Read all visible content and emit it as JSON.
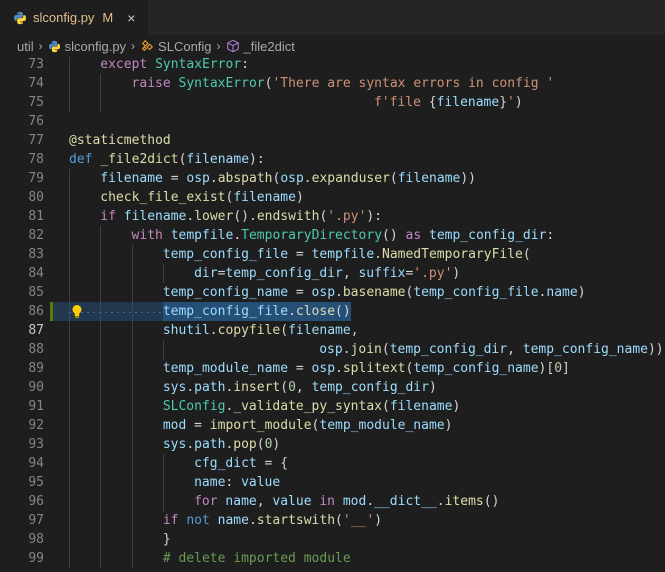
{
  "tab": {
    "filename": "slconfig.py",
    "status": "M",
    "close": "×"
  },
  "breadcrumb": {
    "items": [
      "util",
      "slconfig.py",
      "SLConfig",
      "_file2dict"
    ],
    "sep": "›"
  },
  "lines": [
    {
      "n": "73",
      "tokens": [
        [
          "kw",
          "except"
        ],
        [
          "op",
          " "
        ],
        [
          "cls",
          "SyntaxError"
        ],
        [
          "op",
          ":"
        ]
      ]
    },
    {
      "n": "74",
      "tokens": [
        [
          "kw",
          "raise"
        ],
        [
          "op",
          " "
        ],
        [
          "cls",
          "SyntaxError"
        ],
        [
          "op",
          "("
        ],
        [
          "str",
          "'There are syntax errors in config '"
        ]
      ]
    },
    {
      "n": "75",
      "tokens": [
        [
          "str",
          "f'file "
        ],
        [
          "op",
          "{"
        ],
        [
          "var",
          "filename"
        ],
        [
          "op",
          "}"
        ],
        [
          "str",
          "'"
        ],
        [
          "op",
          ")"
        ]
      ]
    },
    {
      "n": "76",
      "tokens": []
    },
    {
      "n": "77",
      "tokens": [
        [
          "dec",
          "@staticmethod"
        ]
      ]
    },
    {
      "n": "78",
      "tokens": [
        [
          "kw2",
          "def"
        ],
        [
          "op",
          " "
        ],
        [
          "fn",
          "_file2dict"
        ],
        [
          "op",
          "("
        ],
        [
          "var",
          "filename"
        ],
        [
          "op",
          "):"
        ]
      ]
    },
    {
      "n": "79",
      "tokens": [
        [
          "var",
          "filename"
        ],
        [
          "op",
          " = "
        ],
        [
          "var",
          "osp"
        ],
        [
          "op",
          "."
        ],
        [
          "fn",
          "abspath"
        ],
        [
          "op",
          "("
        ],
        [
          "var",
          "osp"
        ],
        [
          "op",
          "."
        ],
        [
          "fn",
          "expanduser"
        ],
        [
          "op",
          "("
        ],
        [
          "var",
          "filename"
        ],
        [
          "op",
          "))"
        ]
      ]
    },
    {
      "n": "80",
      "tokens": [
        [
          "fn",
          "check_file_exist"
        ],
        [
          "op",
          "("
        ],
        [
          "var",
          "filename"
        ],
        [
          "op",
          ")"
        ]
      ]
    },
    {
      "n": "81",
      "tokens": [
        [
          "kw",
          "if"
        ],
        [
          "op",
          " "
        ],
        [
          "var",
          "filename"
        ],
        [
          "op",
          "."
        ],
        [
          "fn",
          "lower"
        ],
        [
          "op",
          "()."
        ],
        [
          "fn",
          "endswith"
        ],
        [
          "op",
          "("
        ],
        [
          "str",
          "'.py'"
        ],
        [
          "op",
          "):"
        ]
      ]
    },
    {
      "n": "82",
      "tokens": [
        [
          "kw",
          "with"
        ],
        [
          "op",
          " "
        ],
        [
          "var",
          "tempfile"
        ],
        [
          "op",
          "."
        ],
        [
          "cls",
          "TemporaryDirectory"
        ],
        [
          "op",
          "() "
        ],
        [
          "kw",
          "as"
        ],
        [
          "op",
          " "
        ],
        [
          "var",
          "temp_config_dir"
        ],
        [
          "op",
          ":"
        ]
      ]
    },
    {
      "n": "83",
      "tokens": [
        [
          "var",
          "temp_config_file"
        ],
        [
          "op",
          " = "
        ],
        [
          "var",
          "tempfile"
        ],
        [
          "op",
          "."
        ],
        [
          "fn",
          "NamedTemporaryFile"
        ],
        [
          "op",
          "("
        ]
      ]
    },
    {
      "n": "84",
      "tokens": [
        [
          "var",
          "dir"
        ],
        [
          "op",
          "="
        ],
        [
          "var",
          "temp_config_dir"
        ],
        [
          "op",
          ", "
        ],
        [
          "var",
          "suffix"
        ],
        [
          "op",
          "="
        ],
        [
          "str",
          "'.py'"
        ],
        [
          "op",
          ")"
        ]
      ]
    },
    {
      "n": "85",
      "tokens": [
        [
          "var",
          "temp_config_name"
        ],
        [
          "op",
          " = "
        ],
        [
          "var",
          "osp"
        ],
        [
          "op",
          "."
        ],
        [
          "fn",
          "basename"
        ],
        [
          "op",
          "("
        ],
        [
          "var",
          "temp_config_file"
        ],
        [
          "op",
          "."
        ],
        [
          "var",
          "name"
        ],
        [
          "op",
          ")"
        ]
      ]
    },
    {
      "n": "86",
      "tokens": [
        [
          "var",
          "temp_config_file"
        ],
        [
          "op",
          "."
        ],
        [
          "fn",
          "close"
        ],
        [
          "op",
          "()"
        ]
      ]
    },
    {
      "n": "87",
      "tokens": [
        [
          "var",
          "shutil"
        ],
        [
          "op",
          "."
        ],
        [
          "fn",
          "copyfile"
        ],
        [
          "op",
          "("
        ],
        [
          "var",
          "filename"
        ],
        [
          "op",
          ","
        ]
      ]
    },
    {
      "n": "88",
      "tokens": [
        [
          "var",
          "osp"
        ],
        [
          "op",
          "."
        ],
        [
          "fn",
          "join"
        ],
        [
          "op",
          "("
        ],
        [
          "var",
          "temp_config_dir"
        ],
        [
          "op",
          ", "
        ],
        [
          "var",
          "temp_config_name"
        ],
        [
          "op",
          "))"
        ]
      ]
    },
    {
      "n": "89",
      "tokens": [
        [
          "var",
          "temp_module_name"
        ],
        [
          "op",
          " = "
        ],
        [
          "var",
          "osp"
        ],
        [
          "op",
          "."
        ],
        [
          "fn",
          "splitext"
        ],
        [
          "op",
          "("
        ],
        [
          "var",
          "temp_config_name"
        ],
        [
          "op",
          ")["
        ],
        [
          "num",
          "0"
        ],
        [
          "op",
          "]"
        ]
      ]
    },
    {
      "n": "90",
      "tokens": [
        [
          "var",
          "sys"
        ],
        [
          "op",
          "."
        ],
        [
          "var",
          "path"
        ],
        [
          "op",
          "."
        ],
        [
          "fn",
          "insert"
        ],
        [
          "op",
          "("
        ],
        [
          "num",
          "0"
        ],
        [
          "op",
          ", "
        ],
        [
          "var",
          "temp_config_dir"
        ],
        [
          "op",
          ")"
        ]
      ]
    },
    {
      "n": "91",
      "tokens": [
        [
          "cls",
          "SLConfig"
        ],
        [
          "op",
          "."
        ],
        [
          "fn",
          "_validate_py_syntax"
        ],
        [
          "op",
          "("
        ],
        [
          "var",
          "filename"
        ],
        [
          "op",
          ")"
        ]
      ]
    },
    {
      "n": "92",
      "tokens": [
        [
          "var",
          "mod"
        ],
        [
          "op",
          " = "
        ],
        [
          "fn",
          "import_module"
        ],
        [
          "op",
          "("
        ],
        [
          "var",
          "temp_module_name"
        ],
        [
          "op",
          ")"
        ]
      ]
    },
    {
      "n": "93",
      "tokens": [
        [
          "var",
          "sys"
        ],
        [
          "op",
          "."
        ],
        [
          "var",
          "path"
        ],
        [
          "op",
          "."
        ],
        [
          "fn",
          "pop"
        ],
        [
          "op",
          "("
        ],
        [
          "num",
          "0"
        ],
        [
          "op",
          ")"
        ]
      ]
    },
    {
      "n": "94",
      "tokens": [
        [
          "var",
          "cfg_dict"
        ],
        [
          "op",
          " = {"
        ]
      ]
    },
    {
      "n": "95",
      "tokens": [
        [
          "var",
          "name"
        ],
        [
          "op",
          ": "
        ],
        [
          "var",
          "value"
        ]
      ]
    },
    {
      "n": "96",
      "tokens": [
        [
          "kw",
          "for"
        ],
        [
          "op",
          " "
        ],
        [
          "var",
          "name"
        ],
        [
          "op",
          ", "
        ],
        [
          "var",
          "value"
        ],
        [
          "op",
          " "
        ],
        [
          "kw",
          "in"
        ],
        [
          "op",
          " "
        ],
        [
          "var",
          "mod"
        ],
        [
          "op",
          "."
        ],
        [
          "var",
          "__dict__"
        ],
        [
          "op",
          "."
        ],
        [
          "fn",
          "items"
        ],
        [
          "op",
          "()"
        ]
      ]
    },
    {
      "n": "97",
      "tokens": [
        [
          "kw",
          "if"
        ],
        [
          "op",
          " "
        ],
        [
          "kw2",
          "not"
        ],
        [
          "op",
          " "
        ],
        [
          "var",
          "name"
        ],
        [
          "op",
          "."
        ],
        [
          "fn",
          "startswith"
        ],
        [
          "op",
          "("
        ],
        [
          "str",
          "'__'"
        ],
        [
          "op",
          ")"
        ]
      ]
    },
    {
      "n": "98",
      "tokens": [
        [
          "op",
          "}"
        ]
      ]
    },
    {
      "n": "99",
      "tokens": [
        [
          "cmt",
          "# delete imported module"
        ]
      ]
    }
  ]
}
